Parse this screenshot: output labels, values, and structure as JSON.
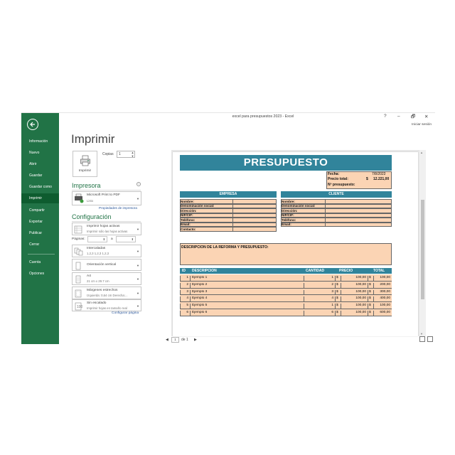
{
  "window": {
    "title": "excel para presupuestos 2023 - Excel",
    "help": "?",
    "minimize": "–",
    "restore": "🗗",
    "close": "✕",
    "signin": "Iniciar sesión"
  },
  "sidebar": {
    "items": [
      {
        "label": "Información"
      },
      {
        "label": "Nuevo"
      },
      {
        "label": "Abrir"
      },
      {
        "label": "Guardar"
      },
      {
        "label": "Guardar como"
      },
      {
        "label": "Imprimir"
      },
      {
        "label": "Compartir"
      },
      {
        "label": "Exportar"
      },
      {
        "label": "Publicar"
      },
      {
        "label": "Cerrar"
      },
      {
        "label": "Cuenta"
      },
      {
        "label": "Opciones"
      }
    ],
    "active_index": 5,
    "color": "#217346",
    "active_color": "#0e5c2f"
  },
  "print": {
    "heading": "Imprimir",
    "print_button": "Imprimir",
    "copies_label": "Copias",
    "copies_value": "1",
    "printer_heading": "Impresora",
    "printer_name": "Microsoft Print to PDF",
    "printer_status": "Listo",
    "printer_properties": "Propiedades de impresora",
    "config_heading": "Configuración",
    "settings": [
      {
        "line1": "Imprimir hojas activas",
        "line2": "Imprimir sólo las hojas activas",
        "icon": "sheets-icon"
      },
      {
        "line1": "",
        "line2": "",
        "icon": ""
      },
      {
        "line1": "Intercaladas",
        "line2": "1,2,3    1,2,3    1,2,3",
        "icon": "collate-icon"
      },
      {
        "line1": "Orientación vertical",
        "line2": "",
        "icon": "portrait-icon"
      },
      {
        "line1": "A4",
        "line2": "21 cm x 29.7 cm",
        "icon": "paper-size-icon"
      },
      {
        "line1": "Márgenes estrechos",
        "line2": "Izquierda: 0,64 cm    Derecha:...",
        "icon": "margins-icon"
      },
      {
        "line1": "Sin escalado",
        "line2": "Imprimir hojas en tamaño real",
        "icon": "scaling-icon"
      }
    ],
    "pages_label": "Páginas:",
    "pages_sep": "a",
    "config_page": "Configurar página"
  },
  "pager": {
    "prev": "◀",
    "current": "1",
    "of": "de 1",
    "next": "▶"
  },
  "quote": {
    "title": "PRESUPUESTO",
    "fecha_label": "Fecha:",
    "fecha_value": "7/8/2023",
    "precio_label": "Precio total:",
    "precio_currency": "$",
    "precio_value": "12.221,00",
    "num_label": "Nº presupuesto:",
    "empresa_header": "EMPRESA",
    "cliente_header": "CLIENTE",
    "empresa_fields": [
      "Nombre:",
      "Denominación social:",
      "Dirección:",
      "NIF/CIF:",
      "Teléfono:",
      "Email:",
      "Contacto:"
    ],
    "cliente_fields": [
      "Nombre:",
      "Denominación social:",
      "Dirección:",
      "NIF/CIF:",
      "Teléfono:",
      "Email:"
    ],
    "desc_label": "DESCRIPCIÓN DE LA REFORMA Y PRESUPUESTO:",
    "table_headers": [
      "ID",
      "DESCRIPCION",
      "CANTIDAD",
      "PRECIO",
      "TOTAL"
    ],
    "rows": [
      {
        "id": "1",
        "desc": "Ejemplo 1",
        "qty": "1",
        "cur1": "$",
        "price": "100,00",
        "cur2": "$",
        "total": "100,00"
      },
      {
        "id": "2",
        "desc": "Ejemplo 2",
        "qty": "2",
        "cur1": "$",
        "price": "100,00",
        "cur2": "$",
        "total": "200,00"
      },
      {
        "id": "3",
        "desc": "Ejemplo 3",
        "qty": "3",
        "cur1": "$",
        "price": "100,00",
        "cur2": "$",
        "total": "300,00"
      },
      {
        "id": "4",
        "desc": "Ejemplo 4",
        "qty": "4",
        "cur1": "$",
        "price": "100,00",
        "cur2": "$",
        "total": "400,00"
      },
      {
        "id": "5",
        "desc": "Ejemplo 5",
        "qty": "1",
        "cur1": "$",
        "price": "100,00",
        "cur2": "$",
        "total": "100,00"
      },
      {
        "id": "6",
        "desc": "Ejemplo 6",
        "qty": "6",
        "cur1": "$",
        "price": "100,00",
        "cur2": "$",
        "total": "600,00"
      }
    ],
    "colors": {
      "header": "#31849b",
      "fill": "#fbd4b4",
      "header_text": "#ffffff"
    }
  }
}
